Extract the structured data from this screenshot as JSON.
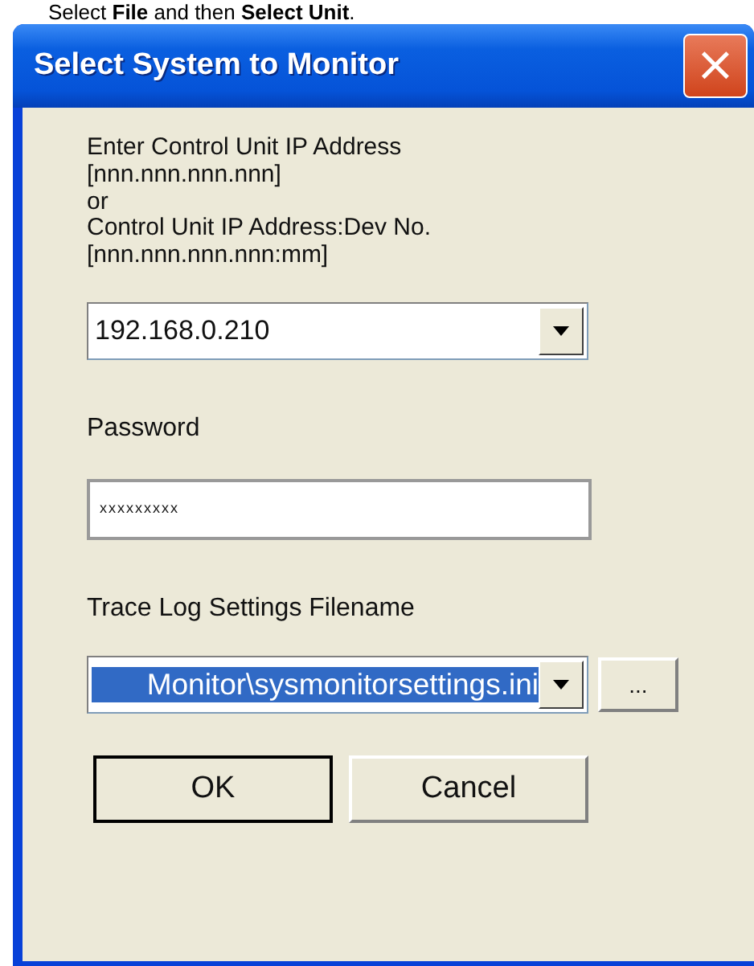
{
  "instruction": "Select **File** and then **Select Unit**.",
  "window": {
    "title": "Select System to Monitor",
    "close": "×"
  },
  "address_label": [
    "Enter Control Unit IP Address",
    "[nnn.nnn.nnn.nnn]",
    "or",
    "Control Unit IP Address:Dev No.",
    "[nnn.nnn.nnn.nnn:mm]"
  ],
  "address_combo": {
    "value": "192.168.0.210",
    "highlighted": false
  },
  "password": {
    "label": "Password",
    "value": "xxxxxxxxx"
  },
  "trace_log": {
    "label": "Trace Log Settings Filename",
    "value": "Monitor\\sysmonitorsettings.ini",
    "highlighted": true,
    "browse": "..."
  },
  "buttons": [
    {
      "label": "OK",
      "default": true
    },
    {
      "label": "Cancel",
      "default": false
    }
  ]
}
